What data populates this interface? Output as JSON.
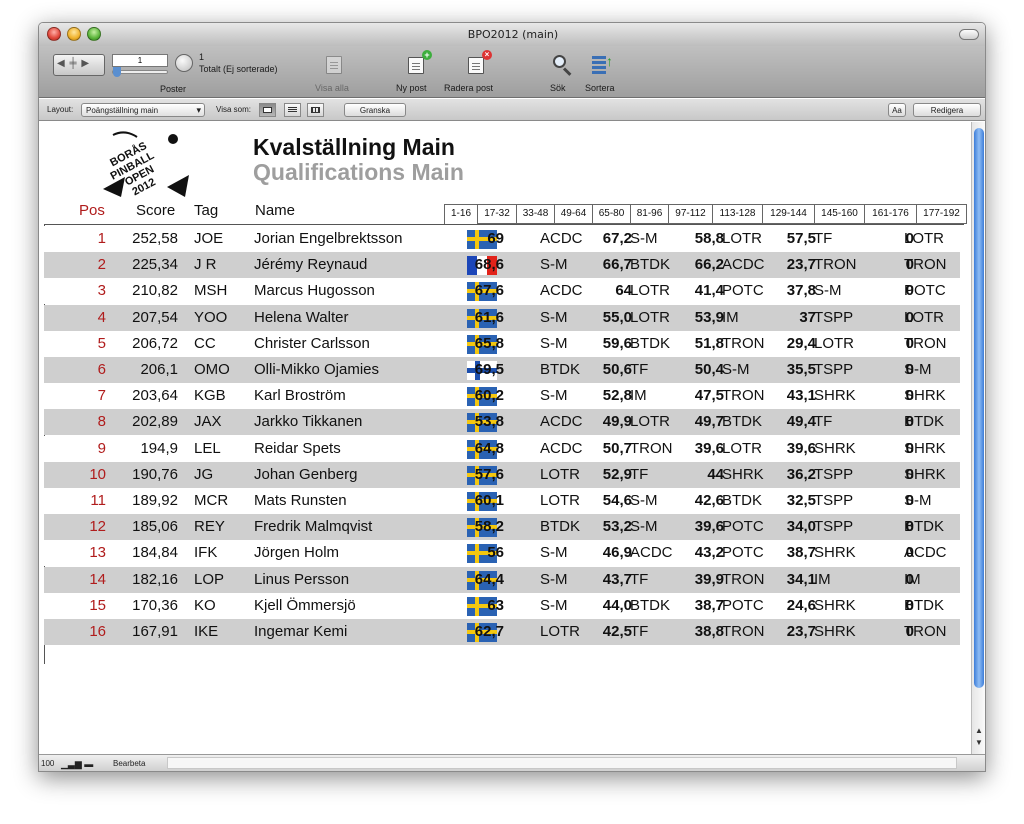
{
  "window": {
    "title": "BPO2012 (main)"
  },
  "toolbar": {
    "record_value": "1",
    "found_count": "1",
    "found_status": "Totalt (Ej sorterade)",
    "records_label": "Poster",
    "show_all_label": "Visa alla",
    "new_record_label": "Ny post",
    "delete_record_label": "Radera post",
    "find_label": "Sök",
    "sort_label": "Sortera"
  },
  "layoutbar": {
    "layout_label": "Layout:",
    "layout_value": "Poängställning main",
    "view_as_label": "Visa som:",
    "preview_label": "Granska",
    "aa_label": "Aa",
    "edit_layout_label": "Redigera"
  },
  "header": {
    "title": "Kvalställning Main",
    "subtitle": "Qualifications Main",
    "columns": {
      "pos": "Pos",
      "score": "Score",
      "tag": "Tag",
      "name": "Name"
    }
  },
  "tabs": [
    "1-16",
    "17-32",
    "33-48",
    "49-64",
    "65-80",
    "81-96",
    "97-112",
    "113-128",
    "129-144",
    "145-160",
    "161-176",
    "177-192"
  ],
  "active_tab": 0,
  "rows": [
    {
      "pos": "1",
      "score": "252,58",
      "tag": "JOE",
      "name": "Jorian Engelbrektsson",
      "flag": "se",
      "games": [
        [
          "69",
          "ACDC"
        ],
        [
          "67,2",
          "S-M"
        ],
        [
          "58,8",
          "LOTR"
        ],
        [
          "57,5",
          "TF"
        ],
        [
          "0",
          "LOTR"
        ]
      ]
    },
    {
      "pos": "2",
      "score": "225,34",
      "tag": "J R",
      "name": "Jérémy Reynaud",
      "flag": "fr",
      "games": [
        [
          "68,6",
          "S-M"
        ],
        [
          "66,7",
          "BTDK"
        ],
        [
          "66,2",
          "ACDC"
        ],
        [
          "23,7",
          "TRON"
        ],
        [
          "0",
          "TRON"
        ]
      ]
    },
    {
      "pos": "3",
      "score": "210,82",
      "tag": "MSH",
      "name": "Marcus Hugosson",
      "flag": "se",
      "games": [
        [
          "67,6",
          "ACDC"
        ],
        [
          "64",
          "LOTR"
        ],
        [
          "41,4",
          "POTC"
        ],
        [
          "37,8",
          "S-M"
        ],
        [
          "0",
          "POTC"
        ]
      ]
    },
    {
      "pos": "4",
      "score": "207,54",
      "tag": "YOO",
      "name": "Helena Walter",
      "flag": "se",
      "games": [
        [
          "61,6",
          "S-M"
        ],
        [
          "55,0",
          "LOTR"
        ],
        [
          "53,9",
          "IM"
        ],
        [
          "37",
          "TSPP"
        ],
        [
          "0",
          "LOTR"
        ]
      ]
    },
    {
      "pos": "5",
      "score": "206,72",
      "tag": "CC",
      "name": "Christer Carlsson",
      "flag": "se",
      "games": [
        [
          "65,8",
          "S-M"
        ],
        [
          "59,6",
          "BTDK"
        ],
        [
          "51,8",
          "TRON"
        ],
        [
          "29,4",
          "LOTR"
        ],
        [
          "0",
          "TRON"
        ]
      ]
    },
    {
      "pos": "6",
      "score": "206,1",
      "tag": "OMO",
      "name": "Olli-Mikko Ojamies",
      "flag": "fi",
      "games": [
        [
          "69,5",
          "BTDK"
        ],
        [
          "50,6",
          "TF"
        ],
        [
          "50,4",
          "S-M"
        ],
        [
          "35,5",
          "TSPP"
        ],
        [
          "0",
          "S-M"
        ]
      ]
    },
    {
      "pos": "7",
      "score": "203,64",
      "tag": "KGB",
      "name": "Karl Broström",
      "flag": "se",
      "games": [
        [
          "60,2",
          "S-M"
        ],
        [
          "52,8",
          "IM"
        ],
        [
          "47,5",
          "TRON"
        ],
        [
          "43,1",
          "SHRK"
        ],
        [
          "0",
          "SHRK"
        ]
      ]
    },
    {
      "pos": "8",
      "score": "202,89",
      "tag": "JAX",
      "name": "Jarkko Tikkanen",
      "flag": "se",
      "games": [
        [
          "53,8",
          "ACDC"
        ],
        [
          "49,9",
          "LOTR"
        ],
        [
          "49,7",
          "BTDK"
        ],
        [
          "49,4",
          "TF"
        ],
        [
          "0",
          "BTDK"
        ]
      ]
    },
    {
      "pos": "9",
      "score": "194,9",
      "tag": "LEL",
      "name": "Reidar Spets",
      "flag": "se",
      "games": [
        [
          "64,8",
          "ACDC"
        ],
        [
          "50,7",
          "TRON"
        ],
        [
          "39,6",
          "LOTR"
        ],
        [
          "39,6",
          "SHRK"
        ],
        [
          "0",
          "SHRK"
        ]
      ]
    },
    {
      "pos": "10",
      "score": "190,76",
      "tag": "JG",
      "name": "Johan Genberg",
      "flag": "se",
      "games": [
        [
          "57,6",
          "LOTR"
        ],
        [
          "52,9",
          "TF"
        ],
        [
          "44",
          "SHRK"
        ],
        [
          "36,2",
          "TSPP"
        ],
        [
          "0",
          "SHRK"
        ]
      ]
    },
    {
      "pos": "11",
      "score": "189,92",
      "tag": "MCR",
      "name": "Mats Runsten",
      "flag": "se",
      "games": [
        [
          "60,1",
          "LOTR"
        ],
        [
          "54,6",
          "S-M"
        ],
        [
          "42,6",
          "BTDK"
        ],
        [
          "32,5",
          "TSPP"
        ],
        [
          "0",
          "S-M"
        ]
      ]
    },
    {
      "pos": "12",
      "score": "185,06",
      "tag": "REY",
      "name": "Fredrik Malmqvist",
      "flag": "se",
      "games": [
        [
          "58,2",
          "BTDK"
        ],
        [
          "53,2",
          "S-M"
        ],
        [
          "39,6",
          "POTC"
        ],
        [
          "34,0",
          "TSPP"
        ],
        [
          "0",
          "BTDK"
        ]
      ]
    },
    {
      "pos": "13",
      "score": "184,84",
      "tag": "IFK",
      "name": "Jörgen Holm",
      "flag": "se",
      "games": [
        [
          "56",
          "S-M"
        ],
        [
          "46,9",
          "ACDC"
        ],
        [
          "43,2",
          "POTC"
        ],
        [
          "38,7",
          "SHRK"
        ],
        [
          "0",
          "ACDC"
        ]
      ]
    },
    {
      "pos": "14",
      "score": "182,16",
      "tag": "LOP",
      "name": "Linus Persson",
      "flag": "se",
      "games": [
        [
          "64,4",
          "S-M"
        ],
        [
          "43,7",
          "TF"
        ],
        [
          "39,9",
          "TRON"
        ],
        [
          "34,1",
          "IM"
        ],
        [
          "0",
          "IM"
        ]
      ]
    },
    {
      "pos": "15",
      "score": "170,36",
      "tag": "KO",
      "name": "Kjell Ömmersjö",
      "flag": "se",
      "games": [
        [
          "63",
          "S-M"
        ],
        [
          "44,0",
          "BTDK"
        ],
        [
          "38,7",
          "POTC"
        ],
        [
          "24,6",
          "SHRK"
        ],
        [
          "0",
          "BTDK"
        ]
      ]
    },
    {
      "pos": "16",
      "score": "167,91",
      "tag": "IKE",
      "name": "Ingemar Kemi",
      "flag": "se",
      "games": [
        [
          "62,7",
          "LOTR"
        ],
        [
          "42,5",
          "TF"
        ],
        [
          "38,8",
          "TRON"
        ],
        [
          "23,7",
          "SHRK"
        ],
        [
          "0",
          "TRON"
        ]
      ]
    }
  ],
  "statusbar": {
    "zoom": "100",
    "mode": "Bearbeta"
  },
  "colors": {
    "pos_red": "#b01c1c",
    "row_alt": "#cfcfcf",
    "subtitle_gray": "#9e9e9e",
    "scroll_blue": "#3d7dd8"
  }
}
